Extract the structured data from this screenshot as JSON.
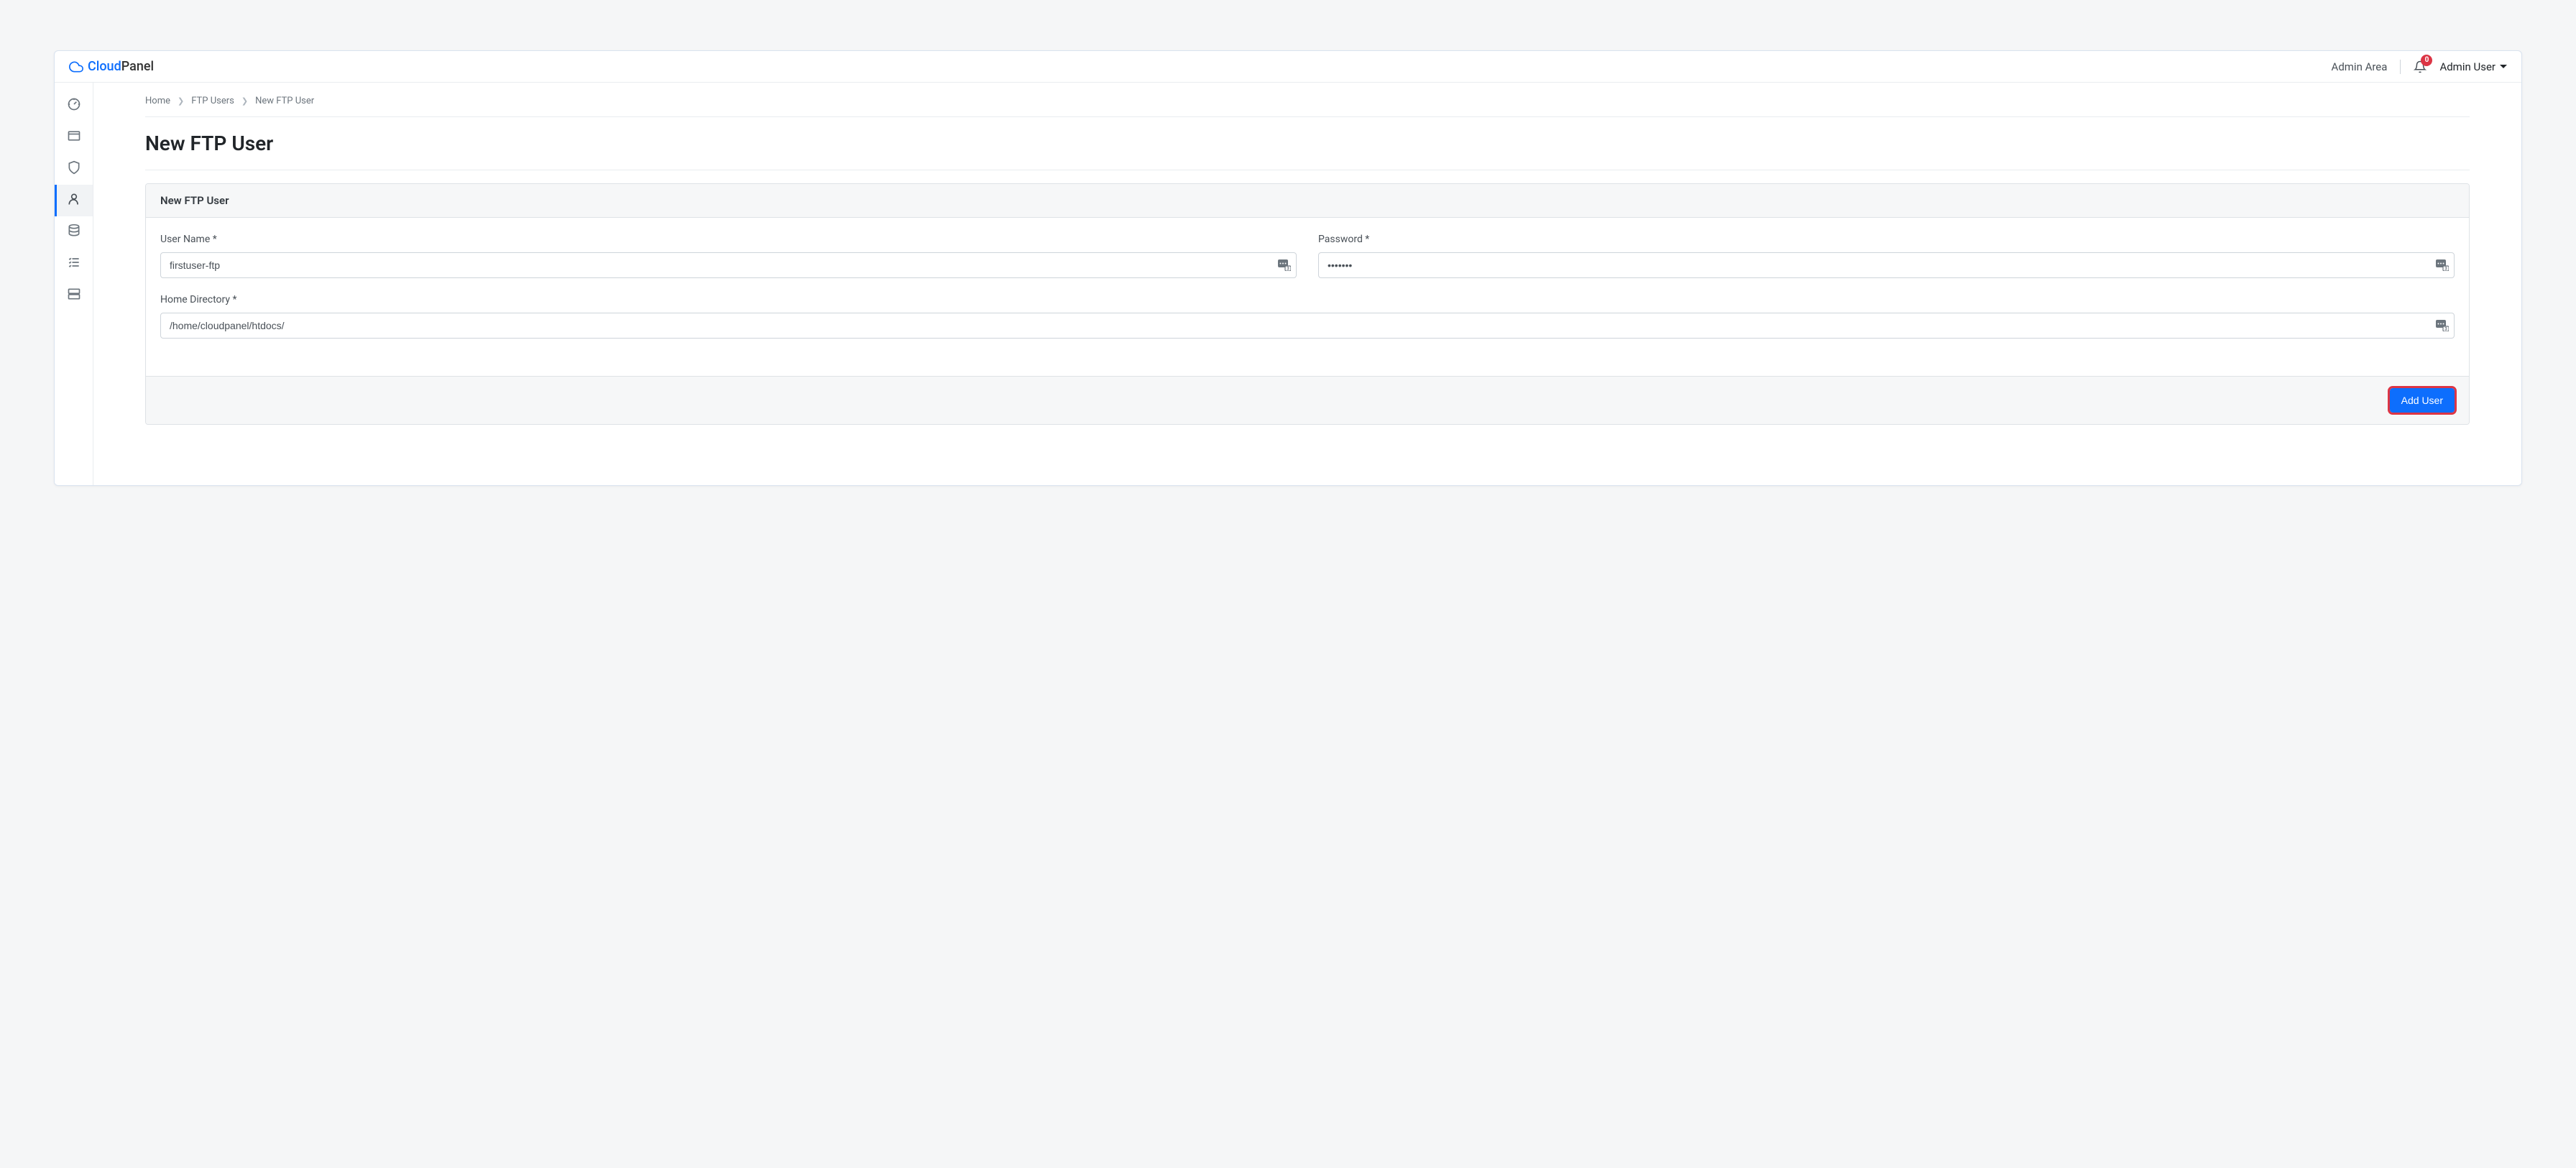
{
  "header": {
    "logo": {
      "cloud": "Cloud",
      "panel": "Panel"
    },
    "admin_area": "Admin Area",
    "notification_count": "0",
    "user_name": "Admin User"
  },
  "breadcrumb": {
    "home": "Home",
    "ftp_users": "FTP Users",
    "current": "New FTP User"
  },
  "page_title": "New FTP User",
  "card": {
    "header": "New FTP User",
    "fields": {
      "user_name": {
        "label": "User Name *",
        "value": "firstuser-ftp"
      },
      "password": {
        "label": "Password *",
        "value": "•••••••"
      },
      "home_directory": {
        "label": "Home Directory *",
        "value": "/home/cloudpanel/htdocs/"
      }
    },
    "submit_label": "Add User"
  }
}
